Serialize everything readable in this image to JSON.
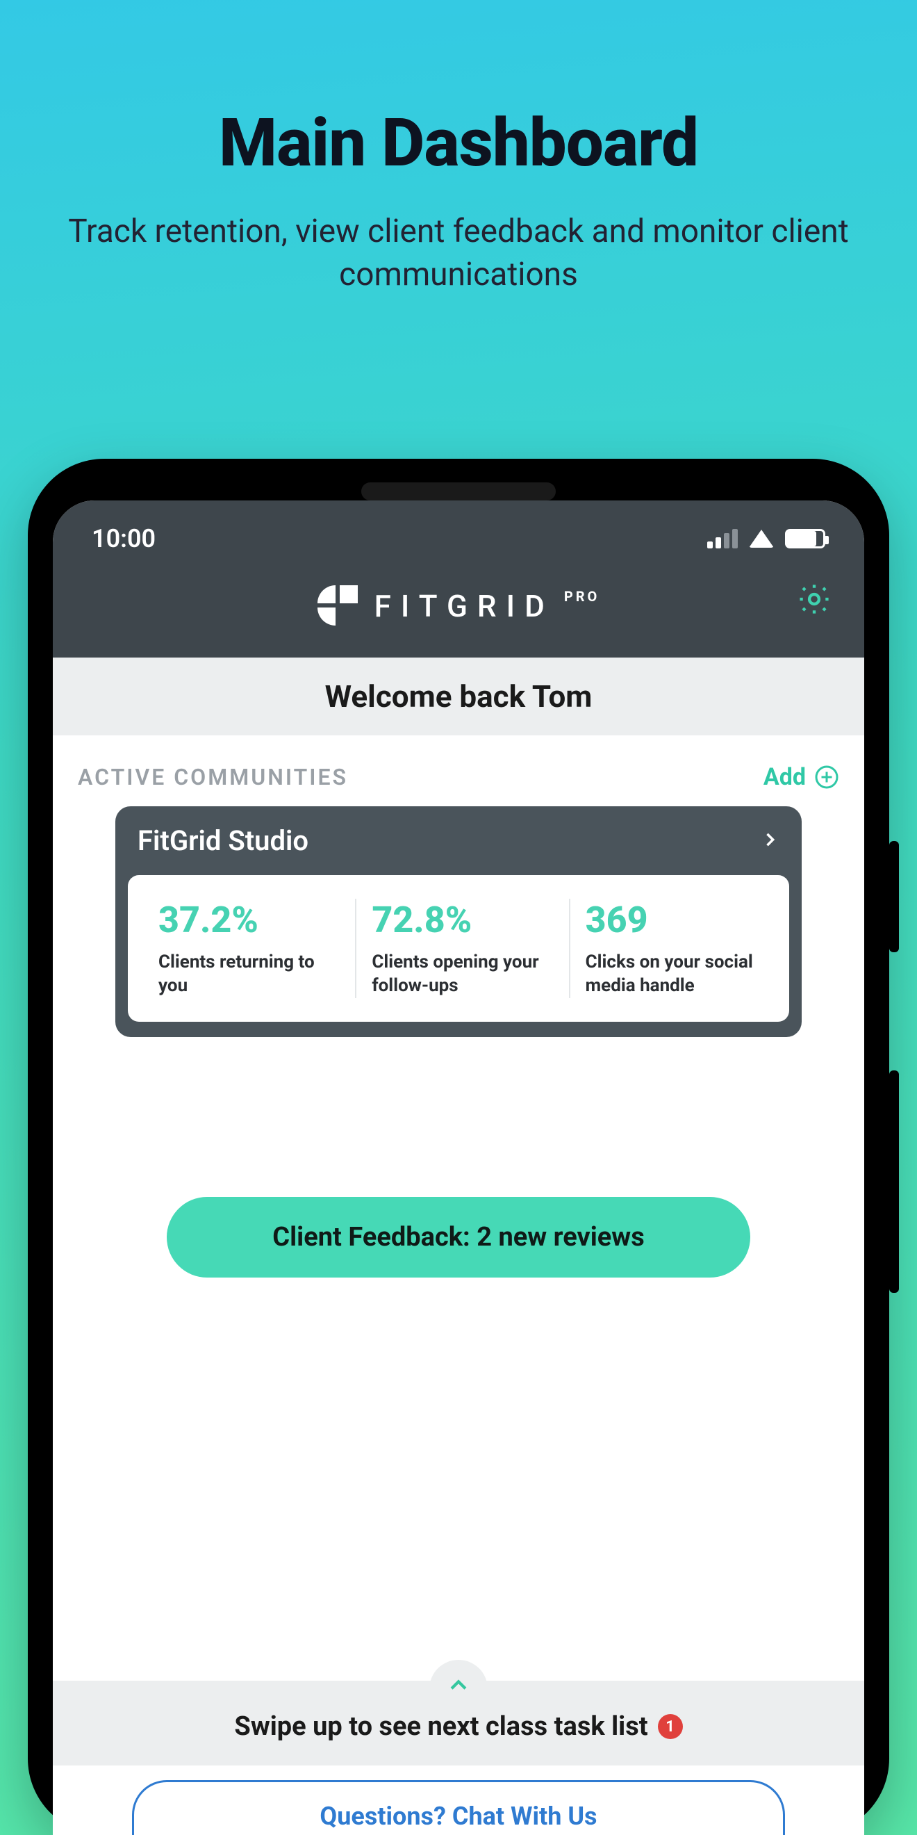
{
  "promo": {
    "title": "Main Dashboard",
    "subtitle": "Track retention, view client feedback and monitor client communications"
  },
  "status": {
    "time": "10:00"
  },
  "brand": {
    "name": "FITGRID",
    "suffix": "PRO"
  },
  "welcome": "Welcome back Tom",
  "communities": {
    "section_label": "ACTIVE COMMUNITIES",
    "add_label": "Add",
    "card": {
      "name": "FitGrid Studio",
      "stats": [
        {
          "value": "37.2%",
          "label": "Clients returning to you"
        },
        {
          "value": "72.8%",
          "label": "Clients opening your follow-ups"
        },
        {
          "value": "369",
          "label": "Clicks on your social media handle"
        }
      ]
    }
  },
  "feedback_button": "Client Feedback: 2 new reviews",
  "swipe": {
    "text": "Swipe up to see next class task list",
    "badge": "1"
  },
  "chat_button": "Questions? Chat With Us"
}
